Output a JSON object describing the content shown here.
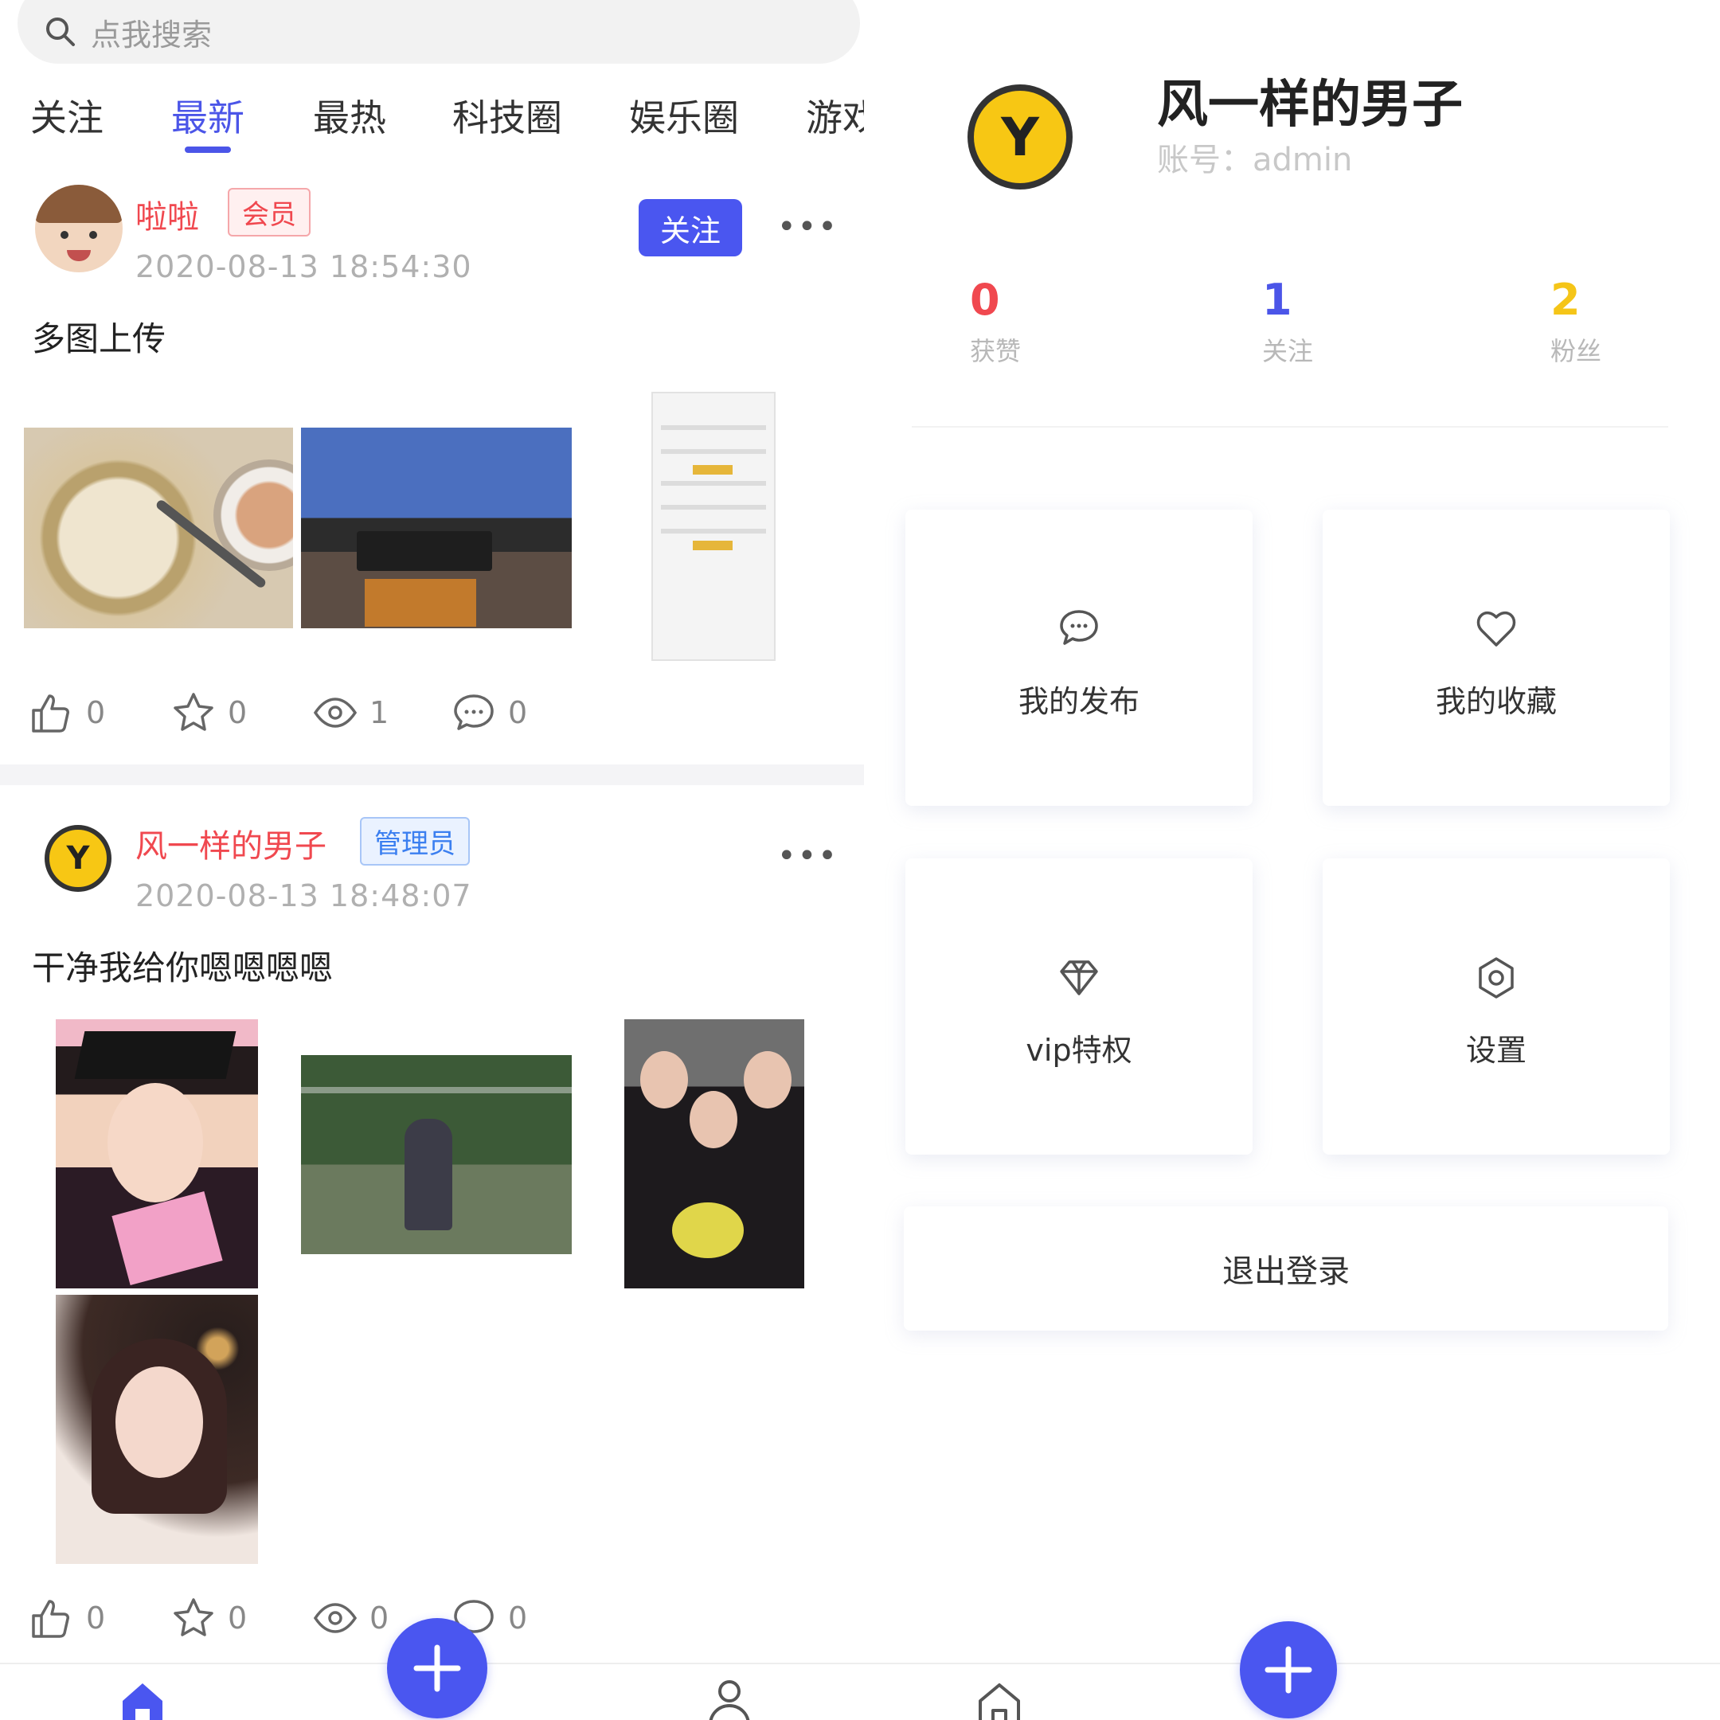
{
  "feed": {
    "search": {
      "placeholder": "点我搜索",
      "icon": "search-icon"
    },
    "tabs": [
      {
        "label": "关注"
      },
      {
        "label": "最新"
      },
      {
        "label": "最热"
      },
      {
        "label": "科技圈"
      },
      {
        "label": "娱乐圈"
      },
      {
        "label": "游戏"
      }
    ],
    "active_tab": "最新",
    "posts": [
      {
        "username": "啦啦",
        "badge": "会员",
        "time": "2020-08-13 18:54:30",
        "follow_label": "关注",
        "text": "多图上传",
        "likes": "0",
        "favorites": "0",
        "views": "1",
        "comments": "0"
      },
      {
        "username": "风一样的男子",
        "badge": "管理员",
        "time": "2020-08-13 18:48:07",
        "text": "干净我给你嗯嗯嗯嗯",
        "likes": "0",
        "favorites": "0",
        "views": "0",
        "comments": "0"
      }
    ]
  },
  "profile": {
    "name": "风一样的男子",
    "account": "账号：admin",
    "avatar_glyph": "Y",
    "stats": [
      {
        "value": "0",
        "label": "获赞",
        "color": "#f0484f"
      },
      {
        "value": "1",
        "label": "关注",
        "color": "#4b55e8"
      },
      {
        "value": "2",
        "label": "粉丝",
        "color": "#f5c518"
      }
    ],
    "menu": [
      {
        "label": "我的发布",
        "icon": "chat-bubble-icon"
      },
      {
        "label": "我的收藏",
        "icon": "heart-icon"
      },
      {
        "label": "vip特权",
        "icon": "diamond-icon"
      },
      {
        "label": "设置",
        "icon": "settings-icon"
      }
    ],
    "logout_label": "退出登录"
  },
  "colors": {
    "accent": "#4a56f0",
    "username_red": "#f0484f",
    "admin_blue": "#3b7ff0"
  }
}
